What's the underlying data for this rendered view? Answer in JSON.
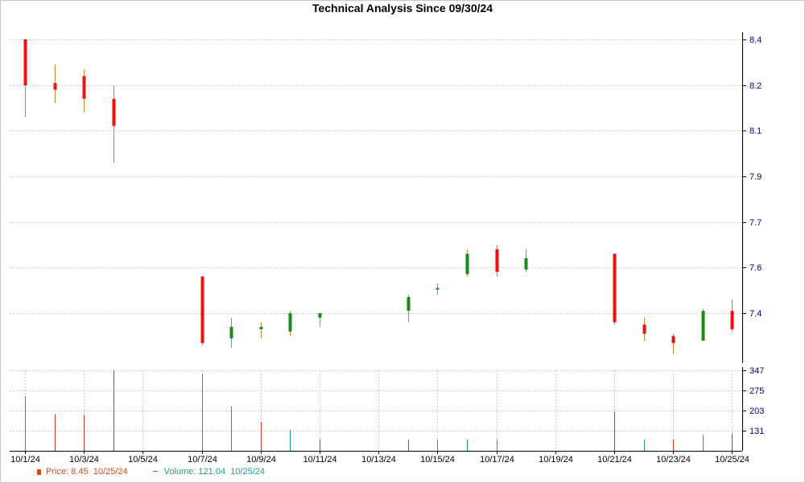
{
  "title": "Technical Analysis Since 09/30/24",
  "legend": {
    "price_label": "Price: 8.45",
    "price_date": "10/25/24",
    "volume_label": "Volume: 121.04",
    "volume_date": "10/25/24"
  },
  "colors": {
    "up": "#1a8a1a",
    "down": "#ee1111",
    "wick": "#c8852a",
    "grid": "#c8c8c8",
    "axis_text": "#000080",
    "vol_up": "#1ea08a",
    "vol_down": "#c0392b"
  },
  "chart_data": {
    "type": "candlestick",
    "x_ticks": [
      "10/1/24",
      "10/3/24",
      "10/5/24",
      "10/7/24",
      "10/9/24",
      "10/11/24",
      "10/13/24",
      "10/15/24",
      "10/17/24",
      "10/19/24",
      "10/21/24",
      "10/23/24",
      "10/25/24"
    ],
    "price_ticks": [
      "8.4",
      "8.2",
      "8.1",
      "7.9",
      "7.7",
      "7.6",
      "7.4"
    ],
    "volume_ticks": [
      "347",
      "275",
      "203",
      "131"
    ],
    "ylim_price": [
      7.3,
      8.4
    ],
    "ylim_volume": [
      60,
      347
    ],
    "candles": [
      {
        "date": "10/1/24",
        "open": 8.4,
        "high": 8.4,
        "low": 8.13,
        "close": 8.2
      },
      {
        "date": "10/2/24",
        "open": 8.21,
        "high": 8.29,
        "low": 8.16,
        "close": 8.19
      },
      {
        "date": "10/3/24",
        "open": 8.24,
        "high": 8.27,
        "low": 8.14,
        "close": 8.17
      },
      {
        "date": "10/4/24",
        "open": 8.17,
        "high": 8.2,
        "low": 7.96,
        "close": 8.11
      },
      {
        "date": "10/7/24",
        "open": 7.56,
        "high": 7.56,
        "low": 7.26,
        "close": 7.27
      },
      {
        "date": "10/8/24",
        "open": 7.29,
        "high": 7.38,
        "low": 7.25,
        "close": 7.34
      },
      {
        "date": "10/9/24",
        "open": 7.33,
        "high": 7.36,
        "low": 7.29,
        "close": 7.34
      },
      {
        "date": "10/10/24",
        "open": 7.32,
        "high": 7.41,
        "low": 7.3,
        "close": 7.4
      },
      {
        "date": "10/11/24",
        "open": 7.38,
        "high": 7.4,
        "low": 7.34,
        "close": 7.4
      },
      {
        "date": "10/14/24",
        "open": 7.41,
        "high": 7.48,
        "low": 7.36,
        "close": 7.47
      },
      {
        "date": "10/15/24",
        "open": 7.51,
        "high": 7.53,
        "low": 7.48,
        "close": 7.51
      },
      {
        "date": "10/16/24",
        "open": 7.57,
        "high": 7.64,
        "low": 7.56,
        "close": 7.63
      },
      {
        "date": "10/17/24",
        "open": 7.64,
        "high": 7.65,
        "low": 7.56,
        "close": 7.58
      },
      {
        "date": "10/18/24",
        "open": 7.59,
        "high": 7.64,
        "low": 7.58,
        "close": 7.62
      },
      {
        "date": "10/21/24",
        "open": 7.63,
        "high": 7.63,
        "low": 7.35,
        "close": 7.36
      },
      {
        "date": "10/22/24",
        "open": 7.35,
        "high": 7.38,
        "low": 7.28,
        "close": 7.31
      },
      {
        "date": "10/23/24",
        "open": 7.3,
        "high": 7.31,
        "low": 7.22,
        "close": 7.27
      },
      {
        "date": "10/24/24",
        "open": 7.28,
        "high": 7.42,
        "low": 7.28,
        "close": 7.41
      },
      {
        "date": "10/25/24",
        "open": 7.41,
        "high": 7.46,
        "low": 7.32,
        "close": 7.33
      }
    ],
    "volume": [
      {
        "date": "10/1/24",
        "value": 255,
        "dir": "up"
      },
      {
        "date": "10/2/24",
        "value": 190,
        "dir": "down"
      },
      {
        "date": "10/3/24",
        "value": 188,
        "dir": "down"
      },
      {
        "date": "10/4/24",
        "value": 348,
        "dir": "down"
      },
      {
        "date": "10/7/24",
        "value": 336,
        "dir": "up"
      },
      {
        "date": "10/8/24",
        "value": 218,
        "dir": "up"
      },
      {
        "date": "10/9/24",
        "value": 163,
        "dir": "down"
      },
      {
        "date": "10/10/24",
        "value": 135,
        "dir": "up"
      },
      {
        "date": "10/11/24",
        "value": 100,
        "dir": "down"
      },
      {
        "date": "10/14/24",
        "value": 100,
        "dir": "down"
      },
      {
        "date": "10/15/24",
        "value": 100,
        "dir": "up"
      },
      {
        "date": "10/16/24",
        "value": 100,
        "dir": "up"
      },
      {
        "date": "10/17/24",
        "value": 100,
        "dir": "up"
      },
      {
        "date": "10/21/24",
        "value": 200,
        "dir": "down"
      },
      {
        "date": "10/22/24",
        "value": 100,
        "dir": "up"
      },
      {
        "date": "10/23/24",
        "value": 100,
        "dir": "down"
      },
      {
        "date": "10/24/24",
        "value": 116,
        "dir": "up"
      },
      {
        "date": "10/25/24",
        "value": 121,
        "dir": "down"
      }
    ]
  }
}
